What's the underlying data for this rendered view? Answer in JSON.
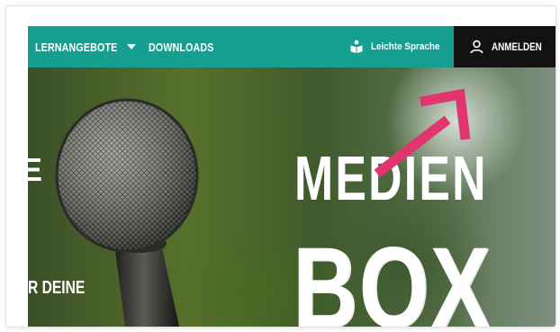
{
  "nav": {
    "lernangebote_label": "LERNANGEBOTE",
    "downloads_label": "DOWNLOADS",
    "leichte_sprache_label": "Leichte Sprache",
    "login_label": "ANMELDEN"
  },
  "hero": {
    "title_line1": "MEDIEN",
    "title_line2": "BOX",
    "left_text": "R DEINE",
    "edge_letter": "E"
  },
  "colors": {
    "nav_background": "#159f90",
    "login_background": "#121212",
    "arrow": "#e0356f"
  }
}
